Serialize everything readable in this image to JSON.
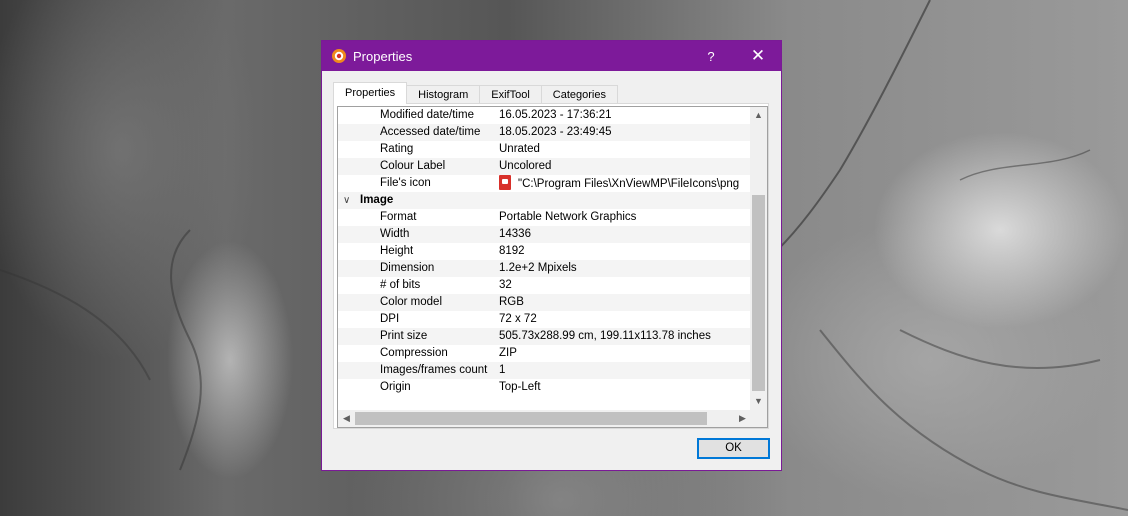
{
  "window": {
    "title": "Properties",
    "help_label": "?",
    "close_label": "✕"
  },
  "tabs": [
    {
      "label": "Properties",
      "active": true
    },
    {
      "label": "Histogram",
      "active": false
    },
    {
      "label": "ExifTool",
      "active": false
    },
    {
      "label": "Categories",
      "active": false
    }
  ],
  "rows": [
    {
      "key": "Modified date/time",
      "value": "16.05.2023 - 17:36:21"
    },
    {
      "key": "Accessed date/time",
      "value": "18.05.2023 - 23:49:45"
    },
    {
      "key": "Rating",
      "value": "Unrated"
    },
    {
      "key": "Colour Label",
      "value": "Uncolored"
    },
    {
      "key": "File's icon",
      "value": "\"C:\\Program Files\\XnViewMP\\FileIcons\\png",
      "icon": "png-file-icon"
    },
    {
      "group": "Image"
    },
    {
      "key": "Format",
      "value": "Portable Network Graphics"
    },
    {
      "key": "Width",
      "value": "14336"
    },
    {
      "key": "Height",
      "value": "8192"
    },
    {
      "key": "Dimension",
      "value": "1.2e+2 Mpixels"
    },
    {
      "key": "# of bits",
      "value": "32"
    },
    {
      "key": "Color model",
      "value": "RGB"
    },
    {
      "key": "DPI",
      "value": "72 x 72"
    },
    {
      "key": "Print size",
      "value": "505.73x288.99 cm, 199.11x113.78 inches"
    },
    {
      "key": "Compression",
      "value": "ZIP"
    },
    {
      "key": "Images/frames count",
      "value": "1"
    },
    {
      "key": "Origin",
      "value": "Top-Left"
    }
  ],
  "buttons": {
    "ok_label": "OK"
  },
  "colors": {
    "titlebar": "#7d1a9a",
    "focus_border": "#0078d7"
  }
}
